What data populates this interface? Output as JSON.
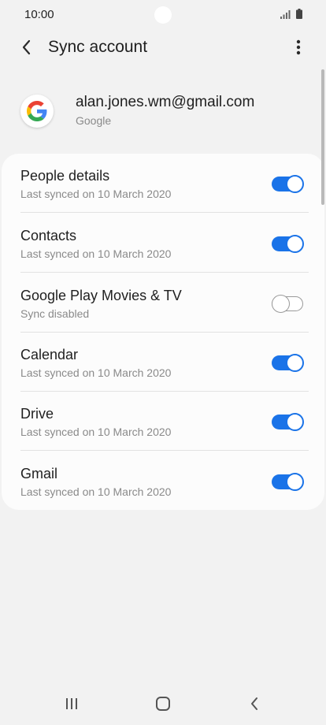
{
  "status_bar": {
    "time": "10:00"
  },
  "app_bar": {
    "title": "Sync account"
  },
  "account": {
    "email": "alan.jones.wm@gmail.com",
    "type": "Google"
  },
  "sync_items": [
    {
      "title": "People details",
      "subtitle": "Last synced on 10 March 2020",
      "enabled": true
    },
    {
      "title": "Contacts",
      "subtitle": "Last synced on 10 March 2020",
      "enabled": true
    },
    {
      "title": "Google Play Movies & TV",
      "subtitle": "Sync disabled",
      "enabled": false
    },
    {
      "title": "Calendar",
      "subtitle": "Last synced on 10 March 2020",
      "enabled": true
    },
    {
      "title": "Drive",
      "subtitle": "Last synced on 10 March 2020",
      "enabled": true
    },
    {
      "title": "Gmail",
      "subtitle": "Last synced on 10 March 2020",
      "enabled": true
    }
  ],
  "colors": {
    "toggle_on": "#1a73e8",
    "toggle_off": "#9a9a9a",
    "background": "#f2f2f2",
    "card": "#fcfcfc"
  },
  "icons": {
    "back": "chevron-left-icon",
    "more": "more-vert-icon",
    "account": "google-logo-icon",
    "nav_recents": "recents-icon",
    "nav_home": "home-icon",
    "nav_back": "back-icon"
  }
}
